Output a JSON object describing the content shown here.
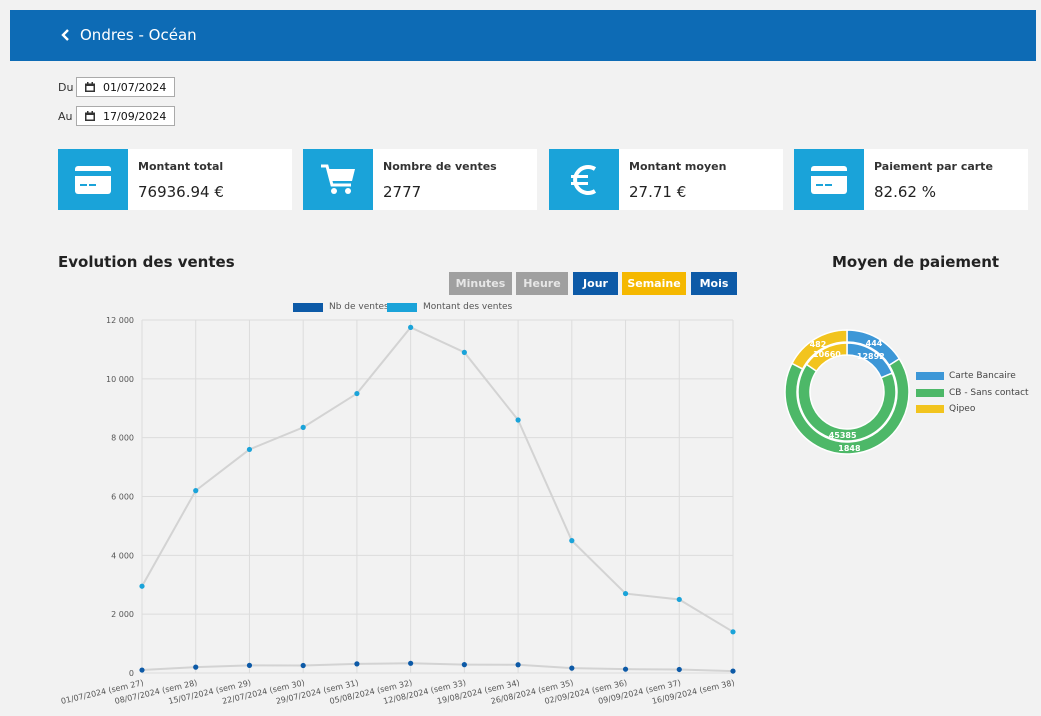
{
  "header": {
    "title": "Ondres - Océan",
    "back_icon": "chevron-left-icon"
  },
  "filters": {
    "from": {
      "label": "Du",
      "value": "01/07/2024"
    },
    "to": {
      "label": "Au",
      "value": "17/09/2024"
    }
  },
  "kpis": [
    {
      "title": "Montant total",
      "value": "76936.94 €",
      "icon": "credit-card-icon"
    },
    {
      "title": "Nombre de ventes",
      "value": "2777",
      "icon": "cart-icon"
    },
    {
      "title": "Montant moyen",
      "value": "27.71 €",
      "icon": "euro-icon"
    },
    {
      "title": "Paiement par carte",
      "value": "82.62 %",
      "icon": "credit-card-icon"
    }
  ],
  "evolution": {
    "title": "Evolution des ventes",
    "buttons": [
      {
        "label": "Minutes",
        "state": "disabled",
        "color": "#a0a0a0"
      },
      {
        "label": "Heure",
        "state": "disabled",
        "color": "#a0a0a0"
      },
      {
        "label": "Jour",
        "state": "enabled",
        "color": "#0d5aa7"
      },
      {
        "label": "Semaine",
        "state": "active",
        "color": "#f5b800"
      },
      {
        "label": "Mois",
        "state": "enabled",
        "color": "#0d5aa7"
      }
    ]
  },
  "payment": {
    "title": "Moyen de paiement",
    "legend": [
      {
        "label": "Carte Bancaire",
        "color": "#3d97d7"
      },
      {
        "label": "CB - Sans contact",
        "color": "#4db868"
      },
      {
        "label": "Qipeo",
        "color": "#f2c41e"
      }
    ]
  },
  "chart_data": [
    {
      "type": "line",
      "categories": [
        "01/07/2024 (sem 27)",
        "08/07/2024 (sem 28)",
        "15/07/2024 (sem 29)",
        "22/07/2024 (sem 30)",
        "29/07/2024 (sem 31)",
        "05/08/2024 (sem 32)",
        "12/08/2024 (sem 33)",
        "19/08/2024 (sem 34)",
        "26/08/2024 (sem 35)",
        "02/09/2024 (sem 36)",
        "09/09/2024 (sem 37)",
        "16/09/2024 (sem 38)"
      ],
      "series": [
        {
          "name": "Nb de ventes",
          "color": "#0d5aa7",
          "values": [
            100,
            200,
            260,
            255,
            310,
            330,
            285,
            280,
            165,
            130,
            120,
            65
          ]
        },
        {
          "name": "Montant des ventes",
          "color": "#1aa3d9",
          "values": [
            2950,
            6200,
            7600,
            8350,
            9500,
            11750,
            10900,
            8600,
            4500,
            2700,
            2500,
            1400
          ]
        }
      ],
      "ylim": [
        0,
        12000
      ],
      "yticks": [
        0,
        2000,
        4000,
        6000,
        8000,
        10000,
        12000
      ],
      "ytick_labels": [
        "0",
        "2 000",
        "4 000",
        "6 000",
        "8 000",
        "10 000",
        "12 000"
      ],
      "grid": true,
      "legend_position": "top"
    },
    {
      "type": "pie",
      "rings": [
        {
          "ring": "outer",
          "values": [
            444,
            1848,
            482
          ],
          "labels": [
            "444",
            "1848",
            "482"
          ]
        },
        {
          "ring": "inner",
          "values": [
            12892,
            45385,
            10660
          ],
          "labels": [
            "12892",
            "45385",
            "10660"
          ]
        }
      ],
      "categories": [
        "Carte Bancaire",
        "CB - Sans contact",
        "Qipeo"
      ],
      "colors": [
        "#3d97d7",
        "#4db868",
        "#f2c41e"
      ],
      "legend_position": "right"
    }
  ]
}
